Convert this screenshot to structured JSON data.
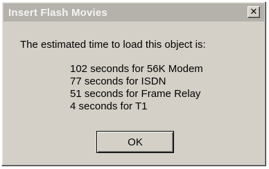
{
  "window": {
    "title": "Insert Flash Movies",
    "close_glyph": "✕"
  },
  "dialog": {
    "message": "The estimated time to load this object is:",
    "estimates": [
      "102 seconds for 56K Modem",
      "77 seconds for ISDN",
      "51 seconds for Frame Relay",
      "4 seconds for T1"
    ],
    "ok_label": "OK"
  },
  "colors": {
    "dialog_face": "#d4d0c8",
    "titlebar_inactive": "#b5b2ac",
    "title_text": "#f4f4f2"
  }
}
